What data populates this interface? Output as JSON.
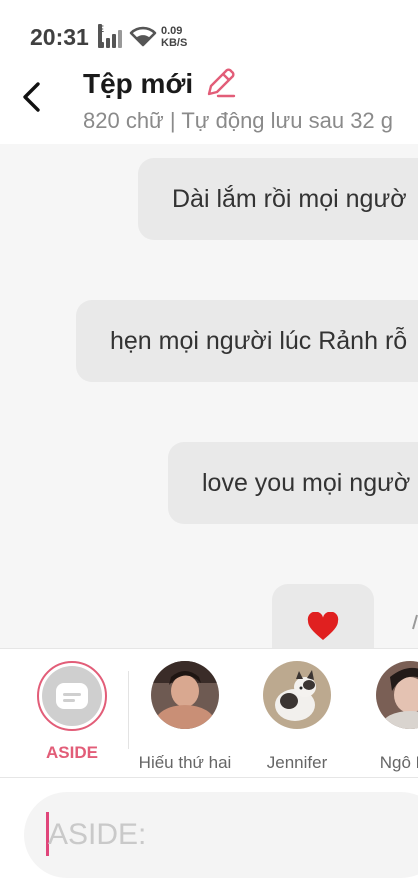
{
  "status_bar": {
    "time": "20:31",
    "network_type": "E",
    "speed_value": "0.09",
    "speed_unit": "KB/S"
  },
  "header": {
    "title": "Tệp mới",
    "subtitle": "820 chữ | Tự động lưu sau 32 g"
  },
  "messages": [
    {
      "text": "Dài lắm rồi mọi ngườ"
    },
    {
      "text": "hẹn mọi người lúc Rảnh rỗ"
    },
    {
      "text": "love you mọi ngườ"
    },
    {
      "emoji": "heart-icon"
    }
  ],
  "characters": [
    {
      "name": "ASIDE",
      "selected": true
    },
    {
      "name": "Hiếu thứ hai"
    },
    {
      "name": "Jennifer"
    },
    {
      "name": "Ngô Kiê"
    }
  ],
  "composer": {
    "placeholder": "ASIDE:"
  },
  "colors": {
    "accent": "#e25d78",
    "heart": "#e02020",
    "bubble": "#e9e9e9"
  }
}
